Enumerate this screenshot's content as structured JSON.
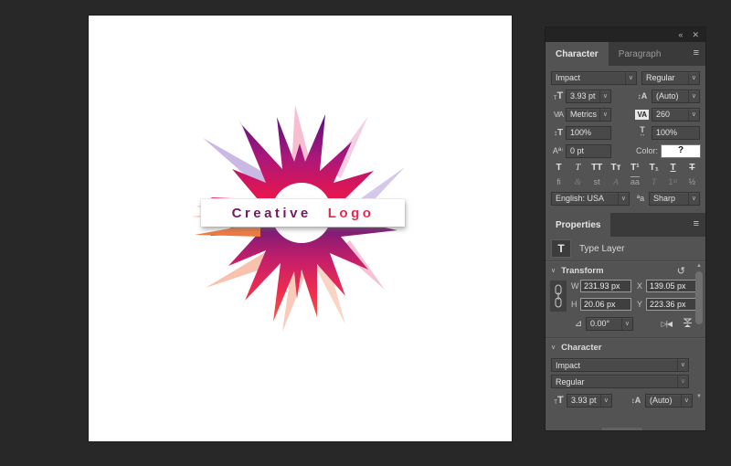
{
  "window_controls": {
    "collapse": "«",
    "close": "✕"
  },
  "canvas": {
    "logo": {
      "text_primary": "Creative",
      "text_secondary": "Logo",
      "primary_color": "#731b60",
      "secondary_color": "#e62950"
    }
  },
  "character_panel": {
    "tabs": [
      {
        "label": "Character"
      },
      {
        "label": "Paragraph"
      }
    ],
    "font_family": "Impact",
    "font_style": "Regular",
    "font_size": "3.93 pt",
    "leading": "(Auto)",
    "kerning": "Metrics",
    "tracking": "260",
    "vertical_scale": "100%",
    "horizontal_scale": "100%",
    "baseline_shift": "0 pt",
    "color_label": "Color:",
    "color_swatch_text": "?",
    "style_buttons": [
      {
        "name": "faux-bold",
        "glyph": "T"
      },
      {
        "name": "faux-italic",
        "glyph": "T"
      },
      {
        "name": "all-caps",
        "glyph": "TT"
      },
      {
        "name": "small-caps",
        "glyph": "Tᴛ"
      },
      {
        "name": "superscript",
        "glyph": "T¹"
      },
      {
        "name": "subscript",
        "glyph": "T₁"
      },
      {
        "name": "underline",
        "glyph": "T"
      },
      {
        "name": "strikethrough",
        "glyph": "T"
      }
    ],
    "opentype_buttons": [
      {
        "name": "standard-ligatures",
        "glyph": "fi"
      },
      {
        "name": "contextual-alternates",
        "glyph": "&"
      },
      {
        "name": "discretionary-ligatures",
        "glyph": "st"
      },
      {
        "name": "swash",
        "glyph": "A"
      },
      {
        "name": "stylistic-alternates",
        "glyph": "aa"
      },
      {
        "name": "titling-alternates",
        "glyph": "T"
      },
      {
        "name": "ordinals",
        "glyph": "1ˢᵗ"
      },
      {
        "name": "fractions",
        "glyph": "½"
      }
    ],
    "language": "English: USA",
    "antialias": "Sharp"
  },
  "properties_panel": {
    "tab": "Properties",
    "layer_label": "Type Layer",
    "transform": {
      "title": "Transform",
      "w_label": "W",
      "w_value": "231.93 px",
      "x_label": "X",
      "x_value": "139.05 px",
      "h_label": "H",
      "h_value": "20.06 px",
      "y_label": "Y",
      "y_value": "223.36 px",
      "angle_value": "0.00°"
    },
    "character": {
      "title": "Character",
      "font_family": "Impact",
      "font_style": "Regular",
      "font_size": "3.93 pt",
      "leading": "(Auto)"
    }
  },
  "colors": {
    "app_background": "#282828",
    "panel_background": "#535353",
    "star_purple": "#45107f",
    "star_magenta": "#c51e69",
    "star_crimson": "#ee1b4d",
    "star_orange": "#f58a52"
  }
}
